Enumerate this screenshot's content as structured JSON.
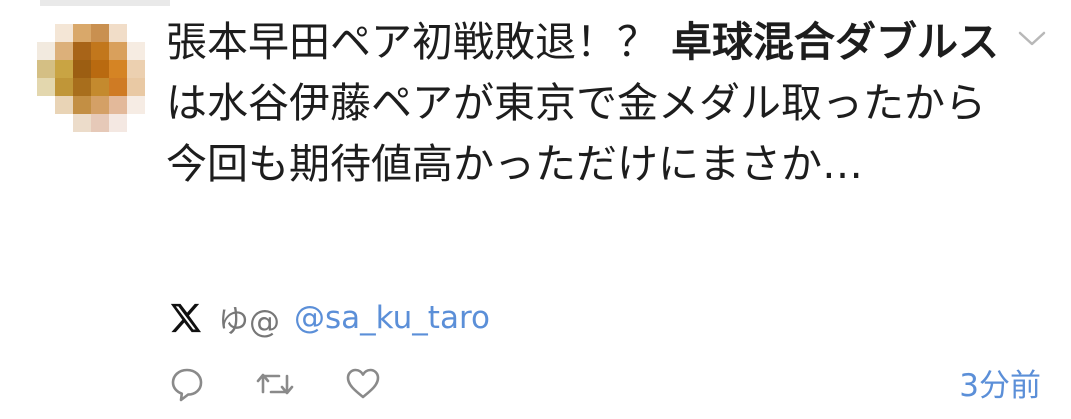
{
  "post": {
    "text_part1": "張本早田ペア初戦敗退！？ ",
    "text_bold": "卓球混合ダブルス",
    "text_part2": "は水谷伊藤ペアが東京で金メダル取ったから今回も期待値高かっただけにまさか…"
  },
  "author": {
    "platform_icon": "x-logo-icon",
    "name": "ゆ@",
    "handle": "@sa_ku_taro"
  },
  "actions": {
    "reply_icon": "speech-bubble-icon",
    "repost_icon": "repost-arrows-icon",
    "like_icon": "heart-icon"
  },
  "timestamp": "3分前",
  "menu_icon": "chevron-down-icon",
  "colors": {
    "text": "#1d1d1d",
    "muted": "#777777",
    "link": "#5b8fd8",
    "icon": "#8a8a8a"
  }
}
